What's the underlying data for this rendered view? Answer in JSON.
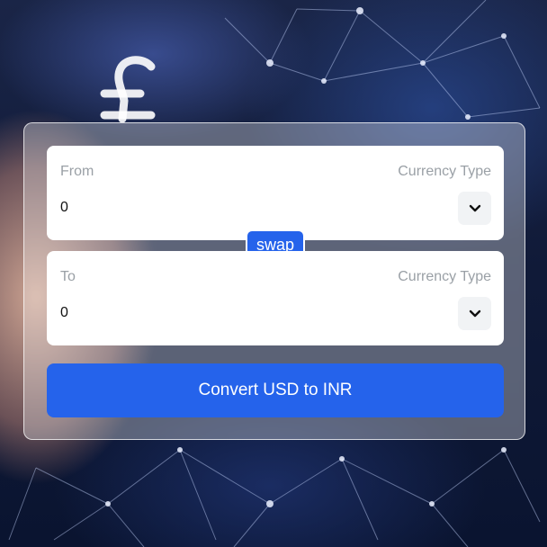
{
  "converter": {
    "from": {
      "label": "From",
      "currency_type_label": "Currency Type",
      "amount": "0"
    },
    "swap_label": "swap",
    "to": {
      "label": "To",
      "currency_type_label": "Currency Type",
      "amount": "0"
    },
    "convert_button_label": "Convert USD to INR"
  },
  "icons": {
    "dropdown": "chevron-down-icon"
  },
  "colors": {
    "accent": "#2563eb",
    "card_background": "#ffffff",
    "muted_text": "#9aa0a6"
  }
}
